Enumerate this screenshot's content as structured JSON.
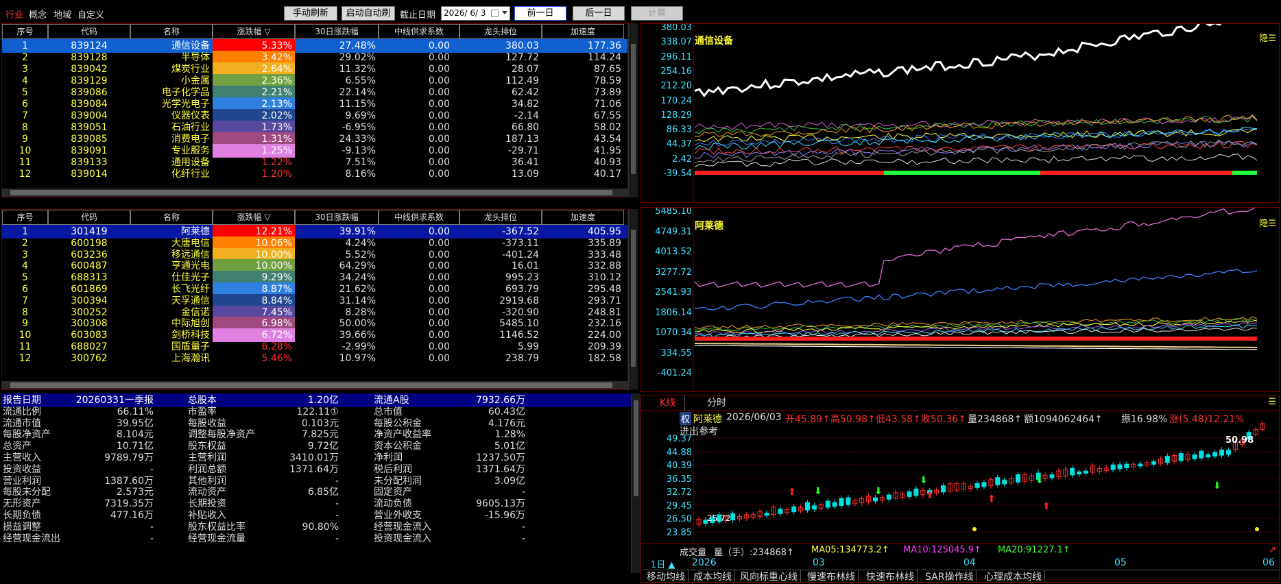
{
  "topbar": {
    "nav": [
      "行业",
      "概念",
      "地域",
      "自定义"
    ],
    "buttons": {
      "manual": "手动刷新",
      "auto": "启动自动刷新",
      "cutoff": "截止日期",
      "prev": "前一日",
      "next": "后一日",
      "calc": "计算"
    },
    "date": "2026/ 6/ 3"
  },
  "headers": [
    "序号",
    "代码",
    "名称",
    "涨跌幅 ▽",
    "30日涨跌幅",
    "中线供求系数",
    "龙头排位",
    "加速度"
  ],
  "industry_rows": [
    {
      "no": "1",
      "code": "839124",
      "name": "通信设备",
      "chg": "5.33%",
      "chg30": "27.48%",
      "coef": "0.00",
      "rank": "380.03",
      "acc": "177.36",
      "bg": "#ff0000"
    },
    {
      "no": "2",
      "code": "839128",
      "name": "半导体",
      "chg": "3.42%",
      "chg30": "29.02%",
      "coef": "0.00",
      "rank": "127.72",
      "acc": "114.24",
      "bg": "#ff8000"
    },
    {
      "no": "3",
      "code": "839042",
      "name": "煤炭行业",
      "chg": "2.64%",
      "chg30": "11.32%",
      "coef": "0.00",
      "rank": "28.07",
      "acc": "87.65",
      "bg": "#f0b020"
    },
    {
      "no": "4",
      "code": "839129",
      "name": "小金属",
      "chg": "2.36%",
      "chg30": "6.55%",
      "coef": "0.00",
      "rank": "112.49",
      "acc": "78.59",
      "bg": "#70a040"
    },
    {
      "no": "5",
      "code": "839086",
      "name": "电子化学品",
      "chg": "2.21%",
      "chg30": "22.14%",
      "coef": "0.00",
      "rank": "62.42",
      "acc": "73.89",
      "bg": "#408070"
    },
    {
      "no": "6",
      "code": "839084",
      "name": "光学光电子",
      "chg": "2.13%",
      "chg30": "11.15%",
      "coef": "0.00",
      "rank": "34.82",
      "acc": "71.06",
      "bg": "#3080e0"
    },
    {
      "no": "7",
      "code": "839004",
      "name": "仪器仪表",
      "chg": "2.02%",
      "chg30": "9.69%",
      "coef": "0.00",
      "rank": "-2.14",
      "acc": "67.55",
      "bg": "#204890"
    },
    {
      "no": "8",
      "code": "839051",
      "name": "石油行业",
      "chg": "1.73%",
      "chg30": "-6.95%",
      "coef": "0.00",
      "rank": "66.80",
      "acc": "58.02",
      "bg": "#5848a0"
    },
    {
      "no": "9",
      "code": "839085",
      "name": "消费电子",
      "chg": "1.31%",
      "chg30": "24.33%",
      "coef": "0.00",
      "rank": "187.13",
      "acc": "43.54",
      "bg": "#a04880"
    },
    {
      "no": "10",
      "code": "839091",
      "name": "专业服务",
      "chg": "1.25%",
      "chg30": "-9.13%",
      "coef": "0.00",
      "rank": "-29.71",
      "acc": "41.95",
      "bg": "#e080e0"
    },
    {
      "no": "11",
      "code": "839133",
      "name": "通用设备",
      "chg": "1.22%",
      "chg30": "7.51%",
      "coef": "0.00",
      "rank": "36.41",
      "acc": "40.93",
      "bg": ""
    },
    {
      "no": "12",
      "code": "839014",
      "name": "化纤行业",
      "chg": "1.20%",
      "chg30": "8.16%",
      "coef": "0.00",
      "rank": "13.09",
      "acc": "40.17",
      "bg": ""
    }
  ],
  "stock_rows": [
    {
      "no": "1",
      "code": "301419",
      "name": "阿莱德",
      "chg": "12.21%",
      "chg30": "39.91%",
      "coef": "0.00",
      "rank": "-367.52",
      "acc": "405.95",
      "bg": "#ff0000"
    },
    {
      "no": "2",
      "code": "600198",
      "name": "大唐电信",
      "chg": "10.06%",
      "chg30": "4.24%",
      "coef": "0.00",
      "rank": "-373.11",
      "acc": "335.89",
      "bg": "#ff8000"
    },
    {
      "no": "3",
      "code": "603236",
      "name": "移远通信",
      "chg": "10.00%",
      "chg30": "5.52%",
      "coef": "0.00",
      "rank": "-401.24",
      "acc": "333.48",
      "bg": "#f0b020"
    },
    {
      "no": "4",
      "code": "600487",
      "name": "亨通光电",
      "chg": "10.00%",
      "chg30": "64.29%",
      "coef": "0.00",
      "rank": "16.01",
      "acc": "332.88",
      "bg": "#70a040"
    },
    {
      "no": "5",
      "code": "688313",
      "name": "仕佳光子",
      "chg": "9.29%",
      "chg30": "34.24%",
      "coef": "0.00",
      "rank": "995.23",
      "acc": "310.12",
      "bg": "#408070"
    },
    {
      "no": "6",
      "code": "601869",
      "name": "长飞光纤",
      "chg": "8.87%",
      "chg30": "21.62%",
      "coef": "0.00",
      "rank": "693.79",
      "acc": "295.48",
      "bg": "#3080e0"
    },
    {
      "no": "7",
      "code": "300394",
      "name": "天孚通信",
      "chg": "8.84%",
      "chg30": "31.14%",
      "coef": "0.00",
      "rank": "2919.68",
      "acc": "293.71",
      "bg": "#204890"
    },
    {
      "no": "8",
      "code": "300252",
      "name": "金信诺",
      "chg": "7.45%",
      "chg30": "8.28%",
      "coef": "0.00",
      "rank": "-320.90",
      "acc": "248.81",
      "bg": "#5848a0"
    },
    {
      "no": "9",
      "code": "300308",
      "name": "中际旭创",
      "chg": "6.98%",
      "chg30": "50.00%",
      "coef": "0.00",
      "rank": "5485.10",
      "acc": "232.16",
      "bg": "#a04880"
    },
    {
      "no": "10",
      "code": "603083",
      "name": "剑桥科技",
      "chg": "6.72%",
      "chg30": "39.66%",
      "coef": "0.00",
      "rank": "1146.52",
      "acc": "224.00",
      "bg": "#e080e0"
    },
    {
      "no": "11",
      "code": "688027",
      "name": "国盾量子",
      "chg": "6.28%",
      "chg30": "-2.99%",
      "coef": "0.00",
      "rank": "5.99",
      "acc": "209.39",
      "bg": ""
    },
    {
      "no": "12",
      "code": "300762",
      "name": "上海瀚讯",
      "chg": "5.46%",
      "chg30": "10.97%",
      "coef": "0.00",
      "rank": "238.79",
      "acc": "182.58",
      "bg": ""
    }
  ],
  "finance": [
    [
      [
        "报告日期",
        "20260331一季报"
      ],
      [
        "总股本",
        "1.20亿"
      ],
      [
        "流通A股",
        "7932.66万"
      ]
    ],
    [
      [
        "流通比例",
        "66.11%"
      ],
      [
        "市盈率",
        "122.11①"
      ],
      [
        "总市值",
        "60.43亿"
      ]
    ],
    [
      [
        "流通市值",
        "39.95亿"
      ],
      [
        "每股收益",
        "0.103元"
      ],
      [
        "每股公积金",
        "4.176元"
      ]
    ],
    [
      [
        "每股净资产",
        "8.104元"
      ],
      [
        "调整每股净资产",
        "7.825元"
      ],
      [
        "净资产收益率",
        "1.28%"
      ]
    ],
    [
      [
        "总资产",
        "10.71亿"
      ],
      [
        "股东权益",
        "9.72亿"
      ],
      [
        "资本公积金",
        "5.01亿"
      ]
    ],
    [
      [
        "主营收入",
        "9789.79万"
      ],
      [
        "主营利润",
        "3410.01万"
      ],
      [
        "净利润",
        "1237.50万"
      ]
    ],
    [
      [
        "投资收益",
        "-"
      ],
      [
        "利润总额",
        "1371.64万"
      ],
      [
        "税后利润",
        "1371.64万"
      ]
    ],
    [
      [
        "营业利润",
        "1387.60万"
      ],
      [
        "其他利润",
        "-"
      ],
      [
        "未分配利润",
        "3.09亿"
      ]
    ],
    [
      [
        "每股未分配",
        "2.573元"
      ],
      [
        "流动资产",
        "6.85亿"
      ],
      [
        "固定资产",
        "-"
      ]
    ],
    [
      [
        "无形资产",
        "7319.35万"
      ],
      [
        "长期投资",
        "-"
      ],
      [
        "流动负债",
        "9605.13万"
      ]
    ],
    [
      [
        "长期负债",
        "477.16万"
      ],
      [
        "补贴收入",
        "-"
      ],
      [
        "营业外收支",
        "-15.96万"
      ]
    ],
    [
      [
        "损益调整",
        "-"
      ],
      [
        "股东权益比率",
        "90.80%"
      ],
      [
        "经营现金流入",
        "-"
      ]
    ],
    [
      [
        "经营现金流出",
        "-"
      ],
      [
        "经营现金流量",
        "-"
      ],
      [
        "投资现金流入",
        "-"
      ]
    ]
  ],
  "charts": {
    "top": {
      "title": "通信设备",
      "hide": "隐",
      "yticks": [
        "380.03",
        "338.07",
        "296.11",
        "254.16",
        "212.20",
        "170.24",
        "128.29",
        "86.33",
        "44.37",
        "2.42",
        "-39.54"
      ]
    },
    "mid": {
      "title": "阿莱德",
      "hide": "隐",
      "yticks": [
        "5485.10",
        "4749.31",
        "4013.52",
        "3277.72",
        "2541.93",
        "1806.14",
        "1070.34",
        "334.55",
        "-401.24"
      ]
    },
    "kline": {
      "tabs": [
        "K线",
        "分时"
      ],
      "rights": "权",
      "name": "阿莱德",
      "date": "2026/06/03",
      "open": "开45.89↑",
      "high": "高50.98↑",
      "low": "低43.58↑",
      "close": "收50.36↑",
      "vol": "量234868↑",
      "amt": "额1094062464↑",
      "amp": "振16.98%",
      "chg": "涨(5.48)12.21%",
      "ref": "进出参考",
      "yticks": [
        "49.37",
        "44.88",
        "40.39",
        "36.35",
        "32.72",
        "29.45",
        "26.50",
        "23.85"
      ],
      "hi_label": "50.98",
      "lo_label": "25.72",
      "vol_line": {
        "label": "成交量",
        "val": "量（手）:234868↑",
        "ma5": "MA05:134773.2↑",
        "ma10": "MA10:125045.9↑",
        "ma20": "MA20:91227.1↑"
      },
      "period": "1日 ▲",
      "xticks": [
        "2026",
        "03",
        "04",
        "05",
        "06"
      ]
    }
  },
  "bottom_tabs": [
    "移动均线",
    "成本均线",
    "风向标重心线",
    "慢速布林线",
    "快速布林线",
    "SAR操作线",
    "心理成本均线"
  ],
  "colors": {
    "up": "#ff3030",
    "down": "#00e0e0",
    "yellow": "#ffff40",
    "cyan": "#40e0ff",
    "selected": "#1060d0"
  }
}
